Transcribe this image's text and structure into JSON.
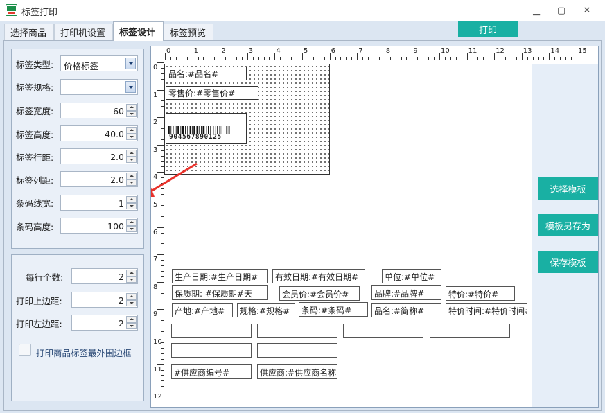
{
  "window": {
    "title": "标签打印",
    "minimize": "▁",
    "maximize": "▢",
    "close": "✕"
  },
  "tabs": [
    {
      "label": "选择商品",
      "active": false
    },
    {
      "label": "打印机设置",
      "active": false
    },
    {
      "label": "标签设计",
      "active": true
    },
    {
      "label": "标签预览",
      "active": false
    }
  ],
  "print_button": "打印",
  "label_settings": {
    "type_label": "标签类型:",
    "type_value": "价格标签",
    "spec_label": "标签规格:",
    "spec_value": "",
    "width_label": "标签宽度:",
    "width_value": "60",
    "height_label": "标签高度:",
    "height_value": "40.0",
    "row_gap_label": "标签行距:",
    "row_gap_value": "2.0",
    "col_gap_label": "标签列距:",
    "col_gap_value": "2.0",
    "barcode_line_label": "条码线宽:",
    "barcode_line_value": "1",
    "barcode_height_label": "条码高度:",
    "barcode_height_value": "100"
  },
  "print_settings": {
    "per_row_label": "每行个数:",
    "per_row_value": "2",
    "top_margin_label": "打印上边距:",
    "top_margin_value": "2",
    "left_margin_label": "打印左边距:",
    "left_margin_value": "2",
    "border_checkbox_label": "打印商品标签最外围边框",
    "border_checked": false
  },
  "ruler": {
    "top": [
      "0",
      "1",
      "2",
      "3",
      "4",
      "5",
      "6",
      "7",
      "8",
      "9",
      "10",
      "11",
      "12",
      "13",
      "14",
      "15"
    ],
    "left": [
      "0",
      "1",
      "2",
      "3",
      "4",
      "5",
      "6",
      "7",
      "8",
      "9",
      "10",
      "11",
      "12"
    ]
  },
  "label_fields": {
    "name": "品名:#品名#",
    "retail_price": "零售价:#零售价#",
    "barcode_digits": "904567890125"
  },
  "palette_fields": {
    "row1": [
      "生产日期:#生产日期#",
      "有效日期:#有效日期#",
      "单位:#单位#"
    ],
    "row2": [
      "保质期: #保质期#天",
      "会员价:#会员价#",
      "品牌:#品牌#",
      "特价:#特价#"
    ],
    "row3": [
      "产地:#产地#",
      "规格:#规格#",
      "条码:#条码#",
      "品名:#简称#",
      "特价时间:#特价时间#"
    ],
    "row4": [
      "",
      "",
      "",
      ""
    ],
    "row5": [
      "",
      ""
    ],
    "row6": [
      "#供应商编号#",
      "供应商:#供应商名称#"
    ]
  },
  "template_buttons": {
    "select": "选择模板",
    "save_as": "模板另存为",
    "save": "保存模板"
  },
  "colors": {
    "accent": "#19b0a3",
    "arrow": "#e8322b",
    "panel": "#eaf0f8"
  }
}
